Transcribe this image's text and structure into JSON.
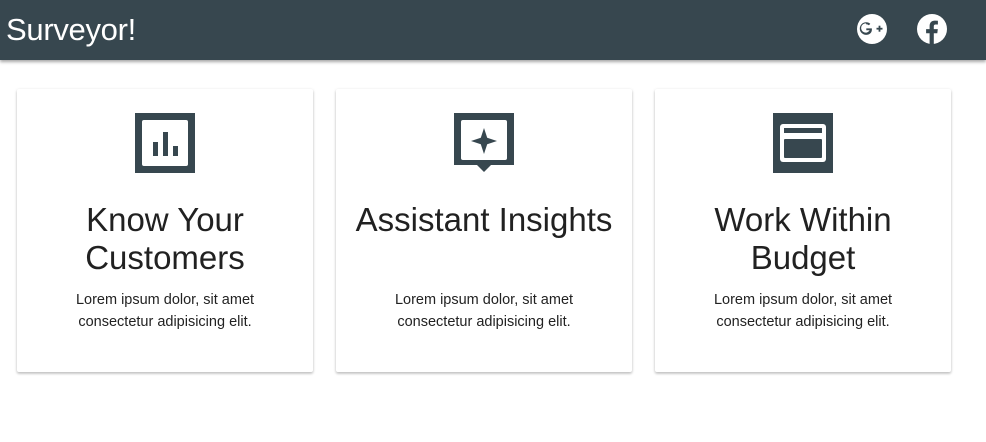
{
  "header": {
    "brand": "Surveyor!",
    "icons": [
      "google-plus-icon",
      "facebook-icon"
    ]
  },
  "colors": {
    "header_bg": "#37474f",
    "icon_fill": "#37474f",
    "text": "#212121"
  },
  "cards": [
    {
      "icon": "bar-chart-icon",
      "title": "Know Your Customers",
      "text": "Lorem ipsum dolor, sit amet consectetur adipisicing elit."
    },
    {
      "icon": "assistant-icon",
      "title": "Assistant Insights",
      "text": "Lorem ipsum dolor, sit amet consectetur adipisicing elit."
    },
    {
      "icon": "credit-card-icon",
      "title": "Work Within Budget",
      "text": "Lorem ipsum dolor, sit amet consectetur adipisicing elit."
    }
  ]
}
